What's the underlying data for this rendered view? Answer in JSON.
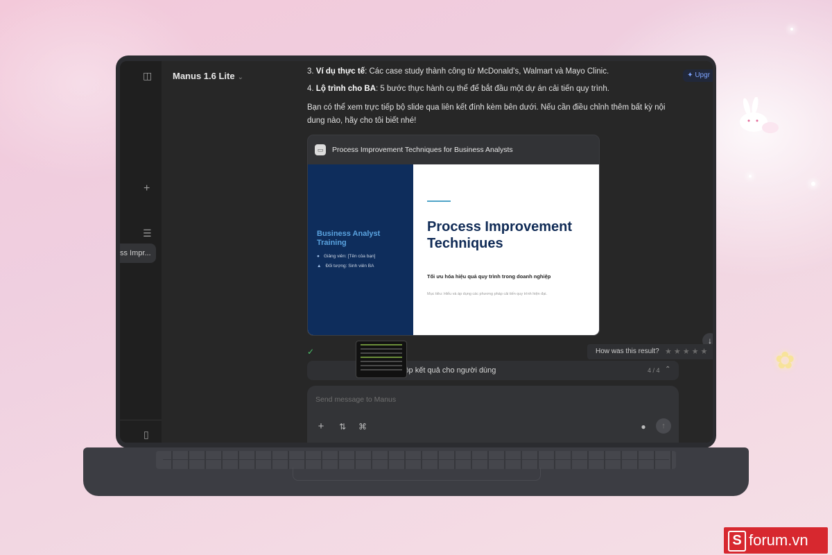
{
  "sidebar": {
    "chip_label": "ss Impr..."
  },
  "header": {
    "model_label": "Manus 1.6 Lite",
    "upgrade_label": "Upgr"
  },
  "message": {
    "items": [
      {
        "num": "3.",
        "bold": "Ví dụ thực tế",
        "rest": ": Các case study thành công từ McDonald's, Walmart và Mayo Clinic."
      },
      {
        "num": "4.",
        "bold": "Lộ trình cho BA",
        "rest": ": 5 bước thực hành cụ thể để bắt đầu một dự án cải tiến quy trình."
      }
    ],
    "paragraph": "Bạn có thể xem trực tiếp bộ slide qua liên kết đính kèm bên dưới. Nếu cần điều chỉnh thêm bất kỳ nội dung nào, hãy cho tôi biết nhé!"
  },
  "card": {
    "title": "Process Improvement Techniques for Business Analysts",
    "slide": {
      "left_title": "Business Analyst Training",
      "instructor": "Giảng viên: [Tên của bạn]",
      "audience": "Đối tượng: Sinh viên BA",
      "main_title": "Process Improvement Techniques",
      "subtitle": "Tối ưu hóa hiệu quả quy trình trong doanh nghiệp",
      "goal": "Mục tiêu: Hiểu và áp dụng các phương pháp cải tiến quy trình hiện đại."
    }
  },
  "rating": {
    "label": "How was this result?",
    "stars": "★★★★★"
  },
  "status": {
    "partial_label": "d"
  },
  "task": {
    "label": "Giao nộp kết quả cho người dùng",
    "count": "4 / 4"
  },
  "composer": {
    "placeholder": "Send message to Manus"
  },
  "watermark": {
    "text": "forum.vn",
    "mark": "S"
  }
}
